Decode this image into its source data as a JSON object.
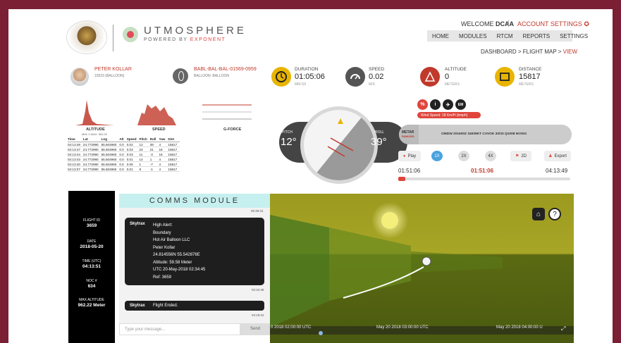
{
  "header": {
    "brand": "UTMOSPHERE",
    "brand_sub_prefix": "POWERED BY ",
    "brand_sub_accent": "EXPONENT",
    "welcome_prefix": "WELCOME ",
    "welcome_user": "DCAA",
    "separator": "|",
    "account_settings": "ACCOUNT SETTINGS",
    "nav": [
      "HOME",
      "MODULES",
      "RTCM",
      "REPORTS",
      "SETTINGS"
    ],
    "breadcrumb": "DASHBOARD > FLIGHT MAP > ",
    "breadcrumb_active": "VIEW"
  },
  "pilot": {
    "name": "PETER KOLLAR",
    "sub": "15523 (BALLOON)"
  },
  "flight": {
    "id": "BABL-BAL-BAL-01569-0959",
    "sub": "BALLOON: BALLOON"
  },
  "stats": {
    "duration": {
      "label": "DURATION",
      "value": "01:05:06",
      "unit": "MM:SS"
    },
    "speed": {
      "label": "SPEED",
      "value": "0.02",
      "unit": "M/S"
    },
    "altitude": {
      "label": "ALTITUDE",
      "value": "0",
      "unit": "METERS"
    },
    "distance": {
      "label": "DISTANCE",
      "value": "15817",
      "unit": "METERS"
    }
  },
  "mini_charts": {
    "altitude": "ALTITUDE",
    "altitude_sub": "MIN: 0  MAX: 963.22",
    "speed": "SPEED",
    "gforce": "G-FORCE"
  },
  "table": {
    "headers": [
      "Time",
      "Lat",
      "Lng",
      "Alt",
      "Speed",
      "Pitch",
      "Roll",
      "Yaw",
      "Dist"
    ],
    "rows": [
      [
        "04:13:49",
        "24.772990",
        "55.504960",
        "0.0",
        "0.02",
        "12",
        "39",
        "4",
        "15817"
      ],
      [
        "04:13:47",
        "24.772990",
        "55.504960",
        "0.0",
        "0.03",
        "24",
        "21",
        "16",
        "15817"
      ],
      [
        "04:13:44",
        "24.772990",
        "55.504960",
        "0.0",
        "0.03",
        "11",
        "-3",
        "16",
        "15817"
      ],
      [
        "04:13:43",
        "24.772990",
        "55.504960",
        "0.0",
        "0.01",
        "14",
        "1",
        "4",
        "15817"
      ],
      [
        "04:13:40",
        "24.772990",
        "55.504960",
        "0.0",
        "0.06",
        "1",
        "-7",
        "4",
        "15817"
      ],
      [
        "04:13:37",
        "24.772990",
        "55.504960",
        "0.0",
        "0.01",
        "8",
        "-1",
        "4",
        "15817"
      ]
    ]
  },
  "attitude": {
    "pitch_label": "PITCH",
    "pitch_value": "12°",
    "roll_label": "ROLL",
    "roll_value": "39°"
  },
  "right": {
    "icons": [
      "%",
      "i",
      "✈",
      "EM"
    ],
    "wind": "Wind Speed: 18 Km/H (kmph)",
    "metar_label": "METAR",
    "metar_sub": "RAW/DEL",
    "metar_text": "OMDW 201600Z 34009KT CAVOK 30/33 Q1008 NOSIG",
    "controls": [
      "Play",
      "1X",
      "2X",
      "4X",
      "2D",
      "Export"
    ],
    "time_start": "01:51:06",
    "time_current": "01:51:06",
    "time_end": "04:13:49",
    "progress": 0.04
  },
  "flight_info": {
    "id_label": "FLIGHT ID",
    "id_value": "3659",
    "date_label": "DATE",
    "date_value": "2018-05-20",
    "time_label": "TIME (UTC)",
    "time_value": "04:13:51",
    "noc_label": "NOC #",
    "noc_value": "634",
    "alt_label": "MAX ALTITUDE",
    "alt_value": "962.22 Meter"
  },
  "comms": {
    "title": "COMMS MODULE",
    "top_time": "00:39:31",
    "msg1_sender": "Skytrax",
    "msg1_lines": [
      "High Alert:",
      "Boundary",
      "Hot Air Balloon LLC",
      "Peter Kollar",
      "24.814556N 55.542876E",
      "Altitude: 59.58 Meter",
      "UTC 20-May-2018 02:34:45",
      "Ref: 3659"
    ],
    "msg1_time": "02:34:48",
    "msg2_sender": "Skytrax",
    "msg2_text": "Flight Ended.",
    "msg2_time": "04:19:22",
    "placeholder": "Type your message...",
    "send": "Send"
  },
  "timeline": {
    "t1": "0 2018 02:00:00 UTC",
    "t2": "May 20 2018 03:00:00 UTC",
    "t3": "May 20 2018 04:00:00 U"
  },
  "colors": {
    "frame": "#7a1f34",
    "accent": "#e0453c",
    "comms_header": "#c6f0ef"
  }
}
